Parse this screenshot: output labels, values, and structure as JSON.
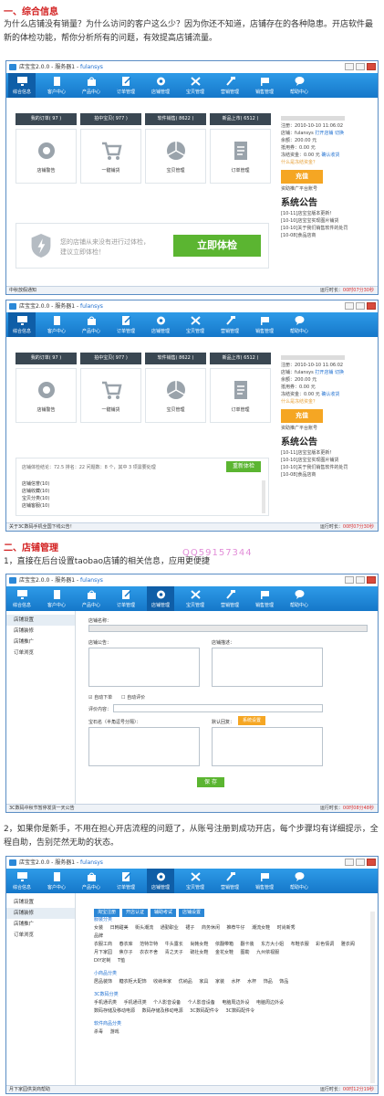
{
  "sections": [
    {
      "heading": "一、综合信息",
      "text": "为什么店铺没有销量？为什么访问的客户这么少？因为你还不知道，店铺存在的各种隐患。开店软件最新的体检功能，帮你分析所有的问题，有效提高店铺流量。"
    },
    {
      "heading": "二、店铺管理",
      "text": "1，直接在后台设置taobao店铺的相关信息，应用更便捷"
    },
    {
      "heading": "",
      "text": "2，如果你是新手，不用在担心开店流程的问题了，从账号注册到成功开店，每个步骤均有详细提示，全程自助，告别茫然无助的状态。"
    }
  ],
  "watermark": "QQ59157344",
  "app": {
    "title": "店宝宝2.0.0 - 服务器1 - ",
    "user": "fulansys",
    "toolbar": [
      "综合信息",
      "客户中心",
      "产品中心",
      "订单管理",
      "店铺管理",
      "宝贝管理",
      "营销管理",
      "销售管理",
      "帮助中心"
    ]
  },
  "win1": {
    "stats": [
      "我的订单( 97 )",
      "拍中宝贝( 977 )",
      "软件销售( 8622 )",
      "新品上市( 6512 )"
    ],
    "tiles": [
      "店铺警告",
      "一键铺货",
      "宝贝管理",
      "订单管理"
    ],
    "banner_text": "您的店铺从来没有进行过体检，建议立即体检！",
    "banner_btn": "立即体检",
    "account": {
      "reg": "注册：2010-10-10 11:06:02",
      "store": "店铺：fulansys",
      "open_link": "打开店铺",
      "switch_link": "切换",
      "balance": "余额：200.00 元",
      "frozen": "抵用券：0.00 元",
      "tip": "冻结资金：0.00 元",
      "withdraw": "确认收货",
      "more": "什么是冻结资金？",
      "recharge": "充值",
      "promo": "资助推广平台账号"
    },
    "notice_title": "系统公告",
    "notices": [
      "[10-11]店宝宝版本更新！",
      "[10-10]店宝宝实现图片铺货",
      "[10-10]关于我们销售软件的处罚",
      "[10-08]食品店商"
    ],
    "status_left": "中秋放假通知",
    "status_rt": "运行时长：",
    "status_time": "00时07分30秒"
  },
  "win2": {
    "stats": [
      "我的订单( 97 )",
      "拍中宝贝( 977 )",
      "软件销售( 8622 )",
      "新品上市( 6512 )"
    ],
    "tiles": [
      "店铺警告",
      "一键铺货",
      "宝贝管理",
      "订单管理"
    ],
    "score_line": "店铺体检结论：72.5 排名：22 问题数：8 个，其中 3 项需要处理",
    "recheck": "重新体检",
    "items": [
      "店铺信誉(10)",
      "店铺收藏(10)",
      "宝贝分类(10)",
      "店铺客服(10)"
    ],
    "account": {
      "reg": "注册：2010-10-10 11:06:02",
      "store": "店铺：fulansys",
      "open_link": "打开店铺",
      "switch_link": "切换",
      "balance": "余额：200.00 元",
      "frozen": "抵用券：0.00 元",
      "tip": "冻结资金：0.00 元",
      "withdraw": "确认收货",
      "more": "什么是冻结资金？",
      "recharge": "充值",
      "promo": "资助推广平台账号"
    },
    "notice_title": "系统公告",
    "notices": [
      "[10-11]店宝宝版本更新！",
      "[10-10]店宝宝实现图片铺货",
      "[10-10]关于我们销售软件的处罚",
      "[10-08]食品店商"
    ],
    "status_left": "关于3C数码手机全国下线公告！",
    "status_rt": "运行时长：",
    "status_time": "00时07分30秒"
  },
  "win3": {
    "sidebar": [
      "店铺设置",
      "店铺装修",
      "店铺推广",
      "订单浏览"
    ],
    "f_name": "店铺名称：",
    "f_notice": "店铺公告：",
    "f_intro": "店铺描述：",
    "chk_auto_ship": "自动下单",
    "chk_auto_rate": "自动评价",
    "f_comment": "评价内容：",
    "f_addr": "宝石名（半角逗号分隔）：",
    "f_reply": "默认回复：",
    "btn_set": "系统设置",
    "btn_save": "保 存",
    "status_left": "3C数码中秋节暂停发货一天公告",
    "status_rt": "运行时长：",
    "status_time": "00时08分48秒"
  },
  "win4": {
    "sidebar": [
      "店铺设置",
      "店铺装修",
      "店铺推广",
      "订单浏览"
    ],
    "chips": [
      "淘宝注册",
      "开店认证",
      "辅助考试",
      "店铺设置"
    ],
    "categories": [
      {
        "name": "服装分类",
        "rows": [
          "女装 日韩甜美 街头潮流 通勤职业 裙子 商务休闲 推荐牛仔 潮流女鞋 时尚新秀",
          "品牌",
          "衣服工商 春衣库 范特华特 牛头露长 尚韩女鞋 依翻带箱 翻卡装 东方大小姐 布鞋衣服 彩色情调 雅衣阁",
          "月下家园 焦尔子 衣衣不舍 青之天子 硫社女鞋 金花女鞋 图勒 九州依视服",
          "DIY定制 T恤"
        ]
      },
      {
        "name": "小商品分类",
        "rows": [
          "居品装饰 糖衣柜大配饰 收纳世家 优纳品 家具 家装 水杯 水杯 饰品 饰品"
        ]
      },
      {
        "name": "3C数码分类",
        "rows": [
          "手机通讯类 手机通讯类 个人影音设备 个人影音设备 电脑周边外设 电脑周边外设",
          "数码存储及移动电源 数码存储及移动电源 3C数码配件令 3C数码配件令"
        ]
      },
      {
        "name": "软件商品分类",
        "rows": [
          "杀毒 游戏"
        ]
      }
    ],
    "status_left": "月下家园供货商帮助",
    "status_rt": "运行时长：",
    "status_time": "00时12分19秒"
  }
}
